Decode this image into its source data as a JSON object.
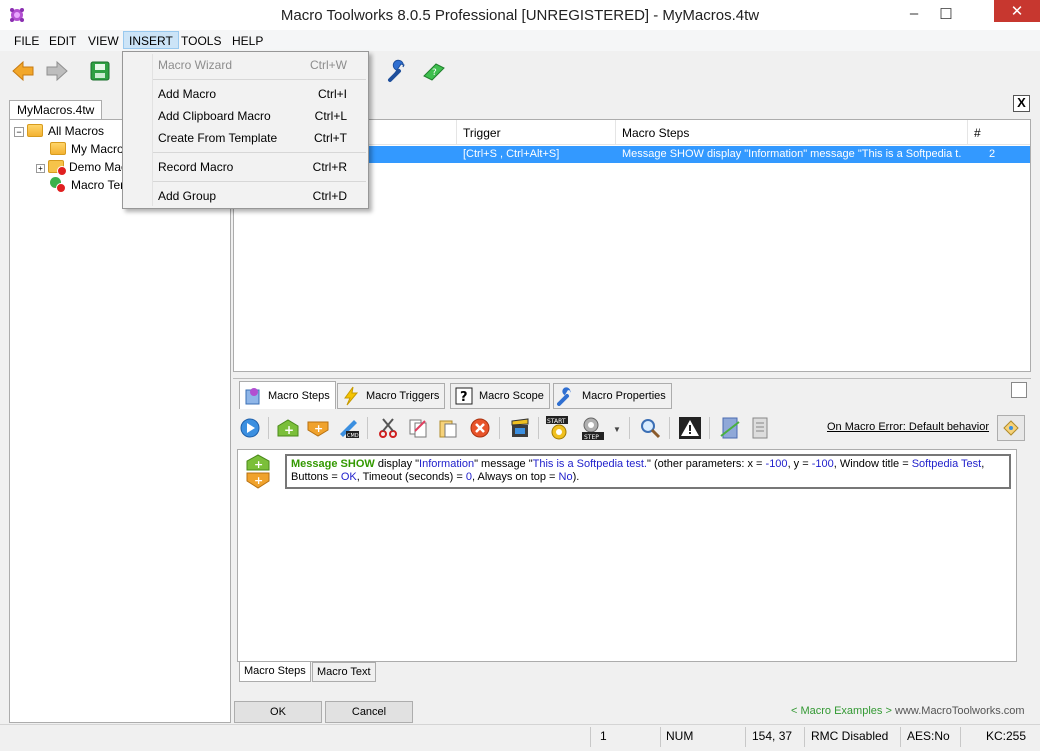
{
  "window": {
    "title": "Macro Toolworks 8.0.5 Professional [UNREGISTERED] - MyMacros.4tw",
    "minimize": "–",
    "maximize": "☐",
    "close": "✕"
  },
  "menu": [
    "FILE",
    "EDIT",
    "VIEW",
    "INSERT",
    "TOOLS",
    "HELP"
  ],
  "menu_active": "INSERT",
  "insert_menu": [
    {
      "label": "Macro Wizard",
      "shortcut": "Ctrl+W",
      "disabled": true
    },
    {
      "label": "Add Macro",
      "shortcut": "Ctrl+I"
    },
    {
      "label": "Add Clipboard Macro",
      "shortcut": "Ctrl+L"
    },
    {
      "label": "Create From Template",
      "shortcut": "Ctrl+T"
    },
    {
      "label": "Record Macro",
      "shortcut": "Ctrl+R"
    },
    {
      "label": "Add Group",
      "shortcut": "Ctrl+D"
    }
  ],
  "doc_tab": "MyMacros.4tw",
  "doc_close": "X",
  "tree": {
    "root": "All Macros",
    "children": [
      "My Macros",
      "Demo Macros",
      "Macro Templates"
    ]
  },
  "list": {
    "headers": {
      "trigger": "Trigger",
      "steps": "Macro Steps",
      "count": "#"
    },
    "rows": [
      {
        "trigger": "[Ctrl+S , Ctrl+Alt+S]",
        "steps": "Message SHOW display \"Information\" message \"This is a Softpedia t...",
        "count": "2"
      }
    ]
  },
  "tabs": [
    "Macro Steps",
    "Macro Triggers",
    "Macro Scope",
    "Macro Properties"
  ],
  "on_error": "On Macro Error: Default behavior",
  "step": {
    "kw1": "Message",
    "kw2": "SHOW",
    "t1": " display \"",
    "v1": "Information",
    "t2": "\" message \"",
    "v2": "This is a Softpedia test.",
    "t3": "\" (other parameters: x = ",
    "v3": "-100",
    "t4": ", y = ",
    "v4": "-100",
    "t5": ", Window title = ",
    "v5": "Softpedia Test",
    "t6": ",",
    "t7": "Buttons = ",
    "v7": "OK",
    "t8": ", Timeout (seconds) = ",
    "v8": "0",
    "t9": ", Always on top = ",
    "v9": "No",
    "t10": ")."
  },
  "sub_tabs": [
    "Macro Steps",
    "Macro Text"
  ],
  "buttons": {
    "ok": "OK",
    "cancel": "Cancel"
  },
  "links": {
    "examples": "< Macro Examples >",
    "site": "www.MacroToolworks.com"
  },
  "status": {
    "one": "1",
    "num": "NUM",
    "pos": "154,  37",
    "rmc": "RMC Disabled",
    "aes": "AES:No",
    "kc": "KC:255"
  }
}
